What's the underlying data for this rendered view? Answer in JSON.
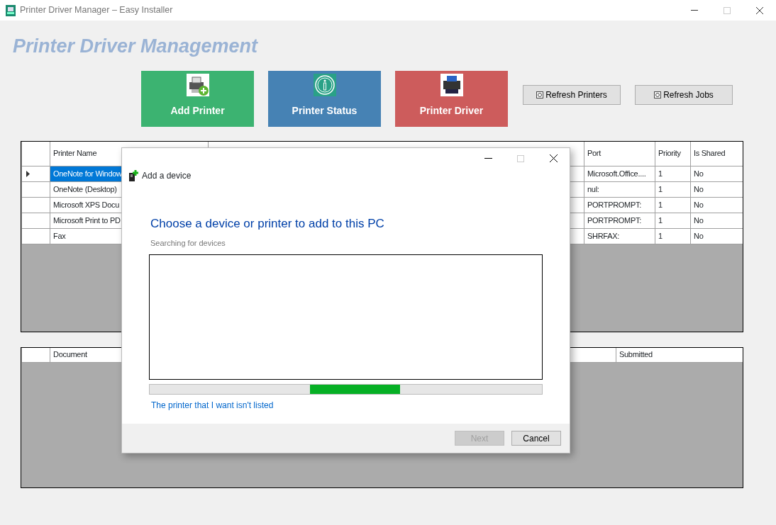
{
  "window": {
    "title": "Printer Driver Manager – Easy Installer"
  },
  "heading": "Printer Driver Management",
  "action_tiles": [
    {
      "label": "Add Printer",
      "kind": "add",
      "color": "#3cb371"
    },
    {
      "label": "Printer Status",
      "kind": "status",
      "color": "#4682b4"
    },
    {
      "label": "Printer Driver",
      "kind": "driver",
      "color": "#cd5c5c"
    }
  ],
  "toolbar_buttons": [
    "Refresh Printers",
    "Refresh Jobs"
  ],
  "printers_grid": {
    "columns": [
      "Printer Name",
      "Port",
      "Priority",
      "Is Shared"
    ],
    "rows": [
      {
        "selected": true,
        "cells": [
          "OneNote for Window",
          "Microsoft.Office....",
          "1",
          "No"
        ]
      },
      {
        "selected": false,
        "cells": [
          "OneNote (Desktop)",
          "nul:",
          "1",
          "No"
        ]
      },
      {
        "selected": false,
        "cells": [
          "Microsoft XPS Docu",
          "PORTPROMPT:",
          "1",
          "No"
        ]
      },
      {
        "selected": false,
        "cells": [
          "Microsoft Print to PD",
          "PORTPROMPT:",
          "1",
          "No"
        ]
      },
      {
        "selected": false,
        "cells": [
          "Fax",
          "SHRFAX:",
          "1",
          "No"
        ]
      }
    ]
  },
  "jobs_grid": {
    "columns": [
      "Document",
      "Submitted"
    ]
  },
  "dialog": {
    "header": "Add a device",
    "title": "Choose a device or printer to add to this PC",
    "status": "Searching for devices",
    "link": "The printer that I want isn't listed",
    "buttons": [
      {
        "label": "Next",
        "disabled": true
      },
      {
        "label": "Cancel",
        "disabled": false
      }
    ]
  }
}
